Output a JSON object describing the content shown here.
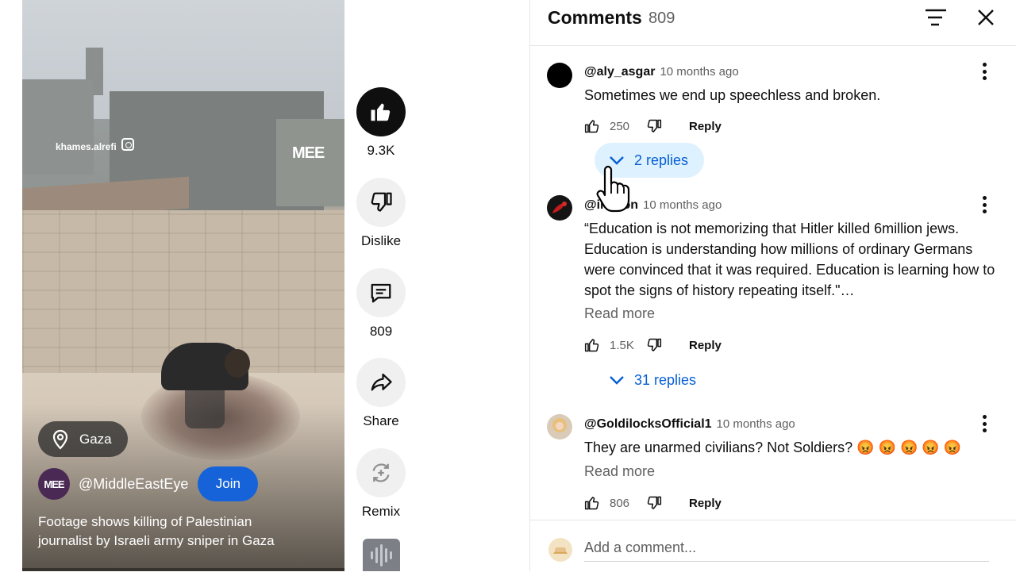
{
  "video": {
    "watermark_user": "khames.alrefi",
    "watermark_logo": "MEE",
    "location": "Gaza",
    "channel_avatar_text": "MEE",
    "channel_name": "@MiddleEastEye",
    "join_label": "Join",
    "title_lines": [
      "Footage shows killing of Palestinian",
      "journalist by Israeli army sniper in Gaza"
    ]
  },
  "actions": {
    "like_count": "9.3K",
    "dislike_label": "Dislike",
    "comments_count": "809",
    "share_label": "Share",
    "remix_label": "Remix"
  },
  "panel": {
    "title": "Comments",
    "count": "809",
    "sort_icon": "sort-icon",
    "close_icon": "close-icon"
  },
  "comments": [
    {
      "handle": "@aly_asgar",
      "time": "10 months ago",
      "lines": [
        "Sometimes we end up speechless and broken."
      ],
      "likes": "250",
      "reply_label": "Reply",
      "replies_label": "2 replies"
    },
    {
      "handle": "@in    aton",
      "time": "10 months ago",
      "lines": [
        "“Education is not memorizing that Hitler killed 6million jews.",
        "Education is understanding how millions of ordinary Germans",
        "were convinced that it was required. Education is learning how to",
        "spot the signs of history repeating itself.\"…"
      ],
      "read_more": "Read more",
      "likes": "1.5K",
      "reply_label": "Reply",
      "replies_label": "31 replies"
    },
    {
      "handle": "@GoldilocksOfficial1",
      "time": "10 months ago",
      "lines": [
        "They are unarmed civilians? Not Soldiers? 😡 😡 😡 😡 😡"
      ],
      "read_more": "Read more",
      "likes": "806",
      "reply_label": "Reply"
    }
  ],
  "add_comment": {
    "placeholder": "Add a comment..."
  },
  "colors": {
    "accent_blue": "#065fd4",
    "replies_highlight": "#def1ff",
    "join_blue": "#1663d9"
  }
}
